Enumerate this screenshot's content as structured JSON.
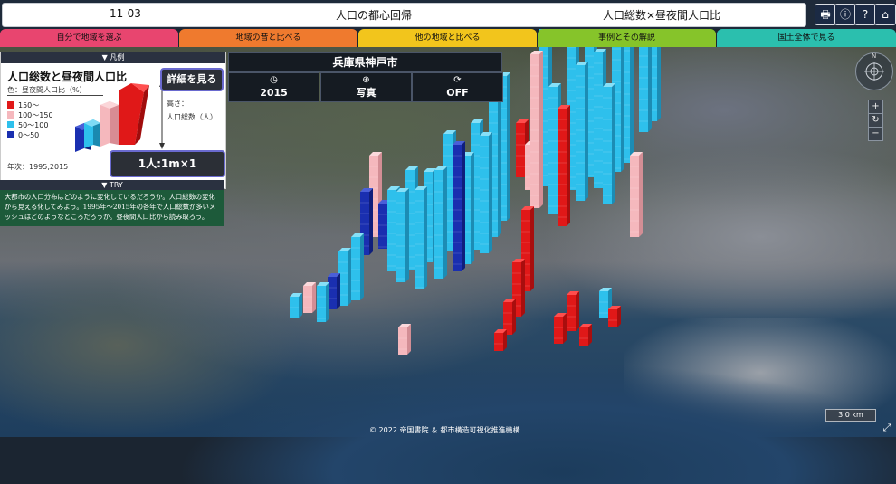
{
  "header": {
    "code": "11-03",
    "title": "人口の都心回帰",
    "subtitle": "人口総数×昼夜間人口比",
    "buttons": [
      {
        "name": "print-icon",
        "glyph": "🖶"
      },
      {
        "name": "info-icon",
        "glyph": "ⓘ"
      },
      {
        "name": "help-icon",
        "glyph": "?"
      },
      {
        "name": "home-icon",
        "glyph": "⌂"
      }
    ]
  },
  "tabs": [
    {
      "label": "自分で地域を選ぶ",
      "color": "#e8456f"
    },
    {
      "label": "地域の昔と比べる",
      "color": "#ef7a2e"
    },
    {
      "label": "他の地域と比べる",
      "color": "#f2c51c"
    },
    {
      "label": "事例とその解説",
      "color": "#86c42a"
    },
    {
      "label": "国土全体で見る",
      "color": "#2bbfae"
    }
  ],
  "legend": {
    "header": "▼ 凡例",
    "title": "人口総数と昼夜間人口比",
    "color_label": "色：昼夜間人口比（%）",
    "classes": [
      {
        "label": "150～",
        "color": "#e01818"
      },
      {
        "label": "100～150",
        "color": "#f5b8bd"
      },
      {
        "label": "50～100",
        "color": "#2ec0ec"
      },
      {
        "label": "0～50",
        "color": "#1a2fb0"
      }
    ],
    "detail_button": "詳細を見る",
    "height_label": "高さ：",
    "height_value": "人口総数（人）",
    "year_label": "年次：1995,2015",
    "scale_button": "1人:1m×1"
  },
  "try": {
    "header": "▼ TRY",
    "text": "大都市の人口分布はどのように変化しているだろうか。人口総数の変化から見える化してみよう。1995年～2015年の各年で人口総数が多いメッシュはどのようなところだろうか。昼夜間人口比から読み取ろう。"
  },
  "place": "兵庫県神戸市",
  "controls": [
    {
      "icon": "clock-icon",
      "glyph": "◷",
      "label": "2015"
    },
    {
      "icon": "globe-icon",
      "glyph": "⊕",
      "label": "写真"
    },
    {
      "icon": "refresh-icon",
      "glyph": "⟳",
      "label": "OFF"
    }
  ],
  "map": {
    "compass_north": "N",
    "zoom_in": "+",
    "rotate": "↻",
    "zoom_out": "−",
    "scale": "3.0 km",
    "fullscreen": "⤢",
    "copyright": "© 2022 帝国書院 ＆ 都市構造可視化推進機構"
  }
}
